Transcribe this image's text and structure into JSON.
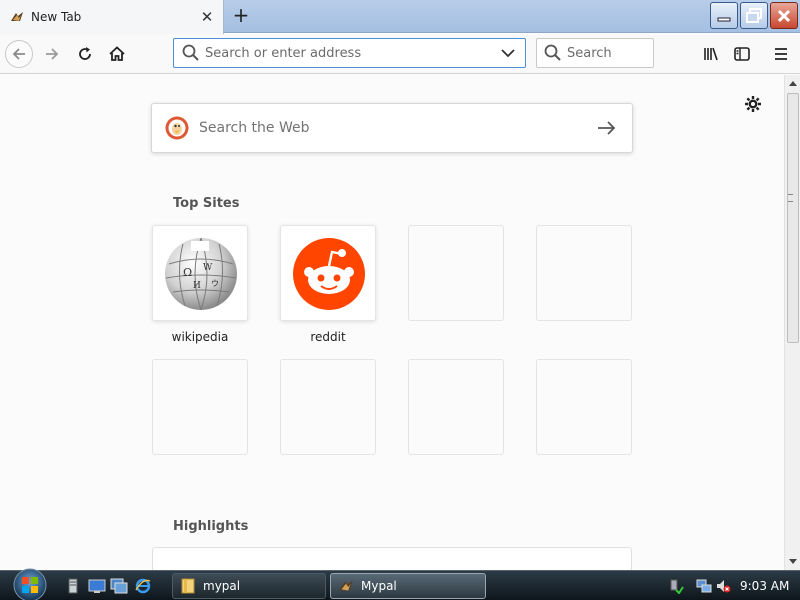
{
  "tab": {
    "title": "New Tab",
    "close_glyph": "✕",
    "favicon": "mypal-icon"
  },
  "new_tab_glyph": "+",
  "window_controls": [
    "minimize-icon",
    "maximize-icon",
    "close-icon"
  ],
  "navbar": {
    "url_placeholder": "Search or enter address",
    "search_placeholder": "Search"
  },
  "newtab_page": {
    "web_search_placeholder": "Search the Web",
    "top_sites_title": "Top Sites",
    "highlights_title": "Highlights",
    "top_sites": [
      {
        "label": "wikipedia",
        "icon": "wikipedia-globe-icon"
      },
      {
        "label": "reddit",
        "icon": "reddit-alien-icon"
      },
      {
        "label": "",
        "icon": ""
      },
      {
        "label": "",
        "icon": ""
      },
      {
        "label": "",
        "icon": ""
      },
      {
        "label": "",
        "icon": ""
      },
      {
        "label": "",
        "icon": ""
      },
      {
        "label": "",
        "icon": ""
      }
    ]
  },
  "taskbar": {
    "tasks": [
      {
        "label": "mypal",
        "icon": "folder-icon"
      },
      {
        "label": "Mypal",
        "icon": "mypal-icon"
      }
    ],
    "clock": "9:03 AM"
  },
  "colors": {
    "accent": "#4a90d9",
    "reddit": "#ff4500",
    "duckduckgo": "#de5833"
  }
}
